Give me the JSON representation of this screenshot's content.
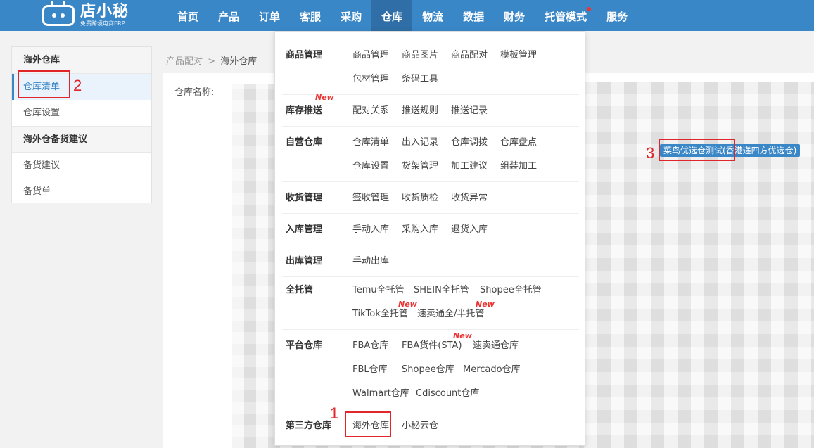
{
  "app": {
    "logo_name": "店小秘",
    "logo_sub": "免费跨境电商ERP"
  },
  "nav": {
    "items": [
      "首页",
      "产品",
      "订单",
      "客服",
      "采购",
      "仓库",
      "物流",
      "数据",
      "财务",
      "托管模式",
      "服务"
    ],
    "active": "仓库"
  },
  "sidebar": {
    "group1": "海外仓库",
    "item_list": "仓库清单",
    "item_settings": "仓库设置",
    "group2": "海外仓备货建议",
    "item_suggest": "备货建议",
    "item_order": "备货单"
  },
  "breadcrumb": {
    "parent": "产品配对",
    "sep": ">",
    "current": "海外仓库"
  },
  "main": {
    "field_label": "仓库名称:",
    "warehouse_tag": "菜鸟优选仓测试(香港递四方优选仓)"
  },
  "dropdown": {
    "new_label": "New",
    "rows": [
      {
        "title": "商品管理",
        "items": [
          "商品管理",
          "商品图片",
          "商品配对",
          "模板管理",
          "包材管理",
          "条码工具"
        ]
      },
      {
        "title": "库存推送",
        "items": [
          "配对关系",
          "推送规则",
          "推送记录"
        ]
      },
      {
        "title": "自营仓库",
        "items": [
          "仓库清单",
          "出入记录",
          "仓库调拨",
          "仓库盘点",
          "仓库设置",
          "货架管理",
          "加工建议",
          "组装加工"
        ]
      },
      {
        "title": "收货管理",
        "items": [
          "签收管理",
          "收货质检",
          "收货异常"
        ]
      },
      {
        "title": "入库管理",
        "items": [
          "手动入库",
          "采购入库",
          "退货入库"
        ]
      },
      {
        "title": "出库管理",
        "items": [
          "手动出库"
        ]
      },
      {
        "title": "全托管",
        "items": [
          "Temu全托管",
          "SHEIN全托管",
          "Shopee全托管",
          "TikTok全托管",
          "速卖通全/半托管"
        ]
      },
      {
        "title": "平台仓库",
        "items": [
          "FBA仓库",
          "FBA货件(STA)",
          "速卖通仓库",
          "FBL仓库",
          "Shopee仓库",
          "Mercado仓库",
          "Walmart仓库",
          "Cdiscount仓库"
        ]
      },
      {
        "title": "第三方仓库",
        "items": [
          "海外仓库",
          "小秘云仓"
        ]
      }
    ]
  },
  "annotations": {
    "n1": "1",
    "n2": "2",
    "n3": "3"
  }
}
